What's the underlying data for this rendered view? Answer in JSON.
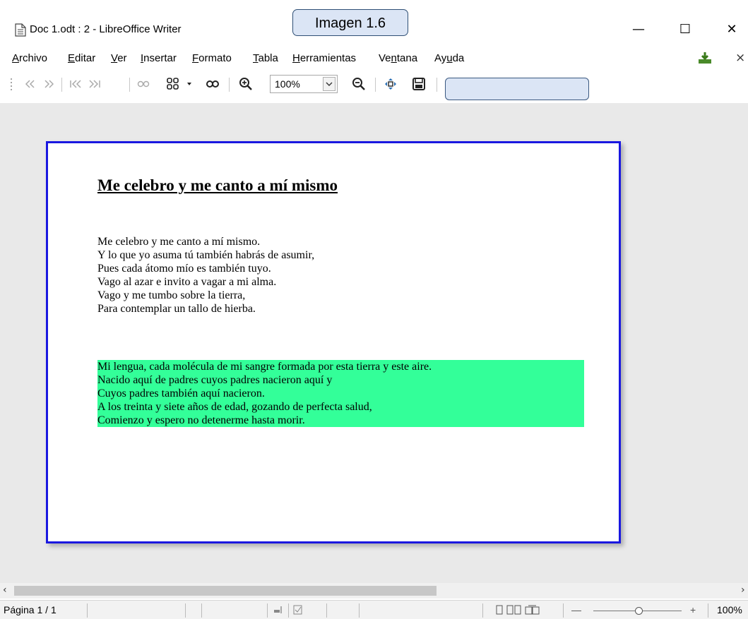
{
  "window": {
    "title": "Doc 1.odt : 2 - LibreOffice Writer",
    "minimize_glyph": "—",
    "maximize_glyph": "☐",
    "close_glyph": "✕"
  },
  "image_label": "Imagen 1.6",
  "menu": {
    "items": [
      {
        "pre": "",
        "u": "A",
        "post": "rchivo"
      },
      {
        "pre": "",
        "u": "E",
        "post": "ditar"
      },
      {
        "pre": "",
        "u": "V",
        "post": "er"
      },
      {
        "pre": "",
        "u": "I",
        "post": "nsertar"
      },
      {
        "pre": "",
        "u": "F",
        "post": "ormato"
      },
      {
        "pre": "",
        "u": "T",
        "post": "abla"
      },
      {
        "pre": "",
        "u": "H",
        "post": "erramientas"
      },
      {
        "pre": "Ve",
        "u": "n",
        "post": "tana"
      },
      {
        "pre": "Ay",
        "u": "u",
        "post": "da"
      }
    ],
    "close_glyph": "×"
  },
  "toolbar": {
    "zoom_value": "100%",
    "icons": [
      "first-page-icon",
      "previous-page-icon",
      "next-page-icon",
      "last-page-icon",
      "single-page-icon",
      "multi-page-icon",
      "book-view-icon",
      "zoom-in-icon",
      "zoom-out-icon",
      "fullscreen-icon",
      "close-preview-icon"
    ]
  },
  "document": {
    "title": "Me celebro y me canto a mí mismo",
    "stanza1": [
      "Me celebro y me canto a mí mismo.",
      "Y lo que yo asuma tú también habrás de asumir,",
      "Pues cada átomo mío es también tuyo.",
      "Vago al azar e invito a vagar a mi alma.",
      "Vago y me tumbo sobre la tierra,",
      "Para contemplar un tallo de hierba."
    ],
    "stanza2": [
      "Mi lengua, cada molécula de mi  sangre formada por esta tierra y este aire.",
      "Nacido aquí de padres cuyos padres nacieron aquí y",
      "Cuyos padres también aquí nacieron.",
      "A los treinta y siete años de edad, gozando de perfecta salud,",
      "Comienzo y espero no detenerme hasta morir."
    ],
    "highlight_color": "#33ff99",
    "page_border_color": "#1a18e0"
  },
  "statusbar": {
    "page": "Página 1 / 1",
    "zoom": "100%",
    "zoom_minus": "—",
    "zoom_plus": "+"
  }
}
